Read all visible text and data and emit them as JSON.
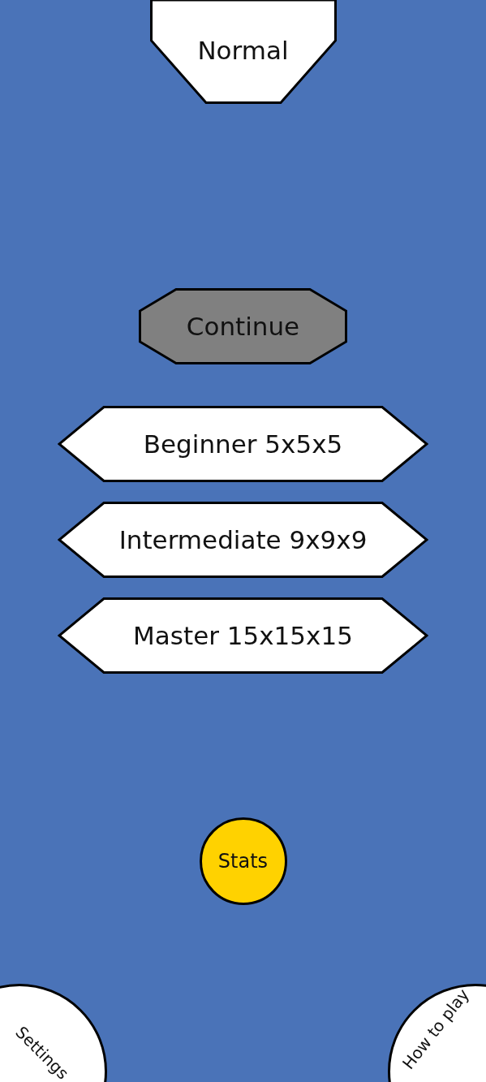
{
  "mode_tab": {
    "label": "Normal"
  },
  "continue_button": {
    "label": "Continue",
    "disabled": true
  },
  "levels": [
    {
      "label": "Beginner 5x5x5"
    },
    {
      "label": "Intermediate 9x9x9"
    },
    {
      "label": "Master 15x15x15"
    }
  ],
  "stats_button": {
    "label": "Stats"
  },
  "corner_buttons": [
    {
      "label": "Settings",
      "kind": "left"
    },
    {
      "label": "How to play",
      "kind": "right"
    }
  ]
}
